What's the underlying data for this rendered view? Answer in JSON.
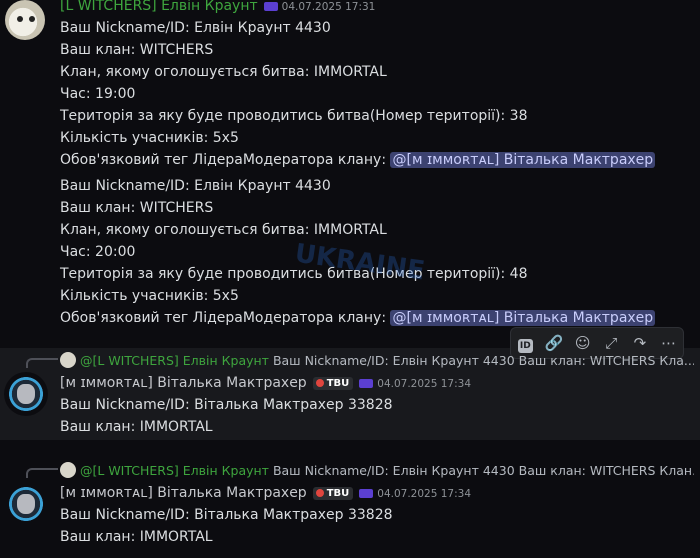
{
  "messages": [
    {
      "author": "[L WITCHERS] Елвін Краунт",
      "timestamp": "04.07.2025 17:31",
      "lines": [
        "Ваш Nickname/ID: Елвін Краунт 4430",
        "Ваш клан: WITCHERS",
        "Клан, якому оголошується битва:  IMMORTAL",
        "Час: 19:00",
        "Територія за яку буде проводитись битва(Номер території): 38",
        "Кількість учасників:  5x5",
        "Обов'язковий тег ЛідераМодератора клану: ",
        "Ваш Nickname/ID: Елвін Краунт 4430",
        "Ваш клан: WITCHERS",
        "Клан, якому оголошується битва:  IMMORTAL",
        "Час: 20:00",
        "Територія за яку буде проводитись битва(Номер території): 48",
        "Кількість учасників:  5x5",
        "Обов'язковий тег ЛідераМодератора клану: "
      ],
      "mention": "@[ᴍ ɪᴍᴍᴏʀᴛᴀʟ] Віталька Мактрахер"
    },
    {
      "reply_author": "@[L WITCHERS] Елвін Краунт",
      "reply_text": "Ваш Nickname/ID: Елвін Краунт 4430 Ваш клан: WITCHERS Кла...",
      "author": "[ᴍ ɪᴍᴍᴏʀᴛᴀʟ] Віталька Мактрахер",
      "tag": "TBU",
      "timestamp": "04.07.2025 17:34",
      "lines": [
        "Ваш Nickname/ID: Віталька Мактрахер 33828",
        "Ваш клан:  IMMORTAL"
      ]
    },
    {
      "reply_author": "@[L WITCHERS] Елвін Краунт",
      "reply_text": "Ваш Nickname/ID: Елвін Краунт 4430 Ваш клан: WITCHERS Клан...",
      "author": "[ᴍ ɪᴍᴍᴏʀᴛᴀʟ] Віталька Мактрахер",
      "tag": "TBU",
      "timestamp": "04.07.2025 17:34",
      "lines": [
        "Ваш Nickname/ID: Віталька Мактрахер 33828",
        "Ваш клан:  IMMORTAL"
      ]
    }
  ],
  "toolbar": {
    "id_label": "ID",
    "icons": [
      "id-icon",
      "link-icon",
      "add-reaction-icon",
      "thread-icon",
      "forward-icon",
      "more-icon"
    ]
  },
  "watermark": "UKRAINE GTA",
  "colors": {
    "background": "#0c0c10",
    "author_green": "#3ea53e",
    "mention_bg": "#3c4270",
    "hover_bg": "#18191d"
  }
}
